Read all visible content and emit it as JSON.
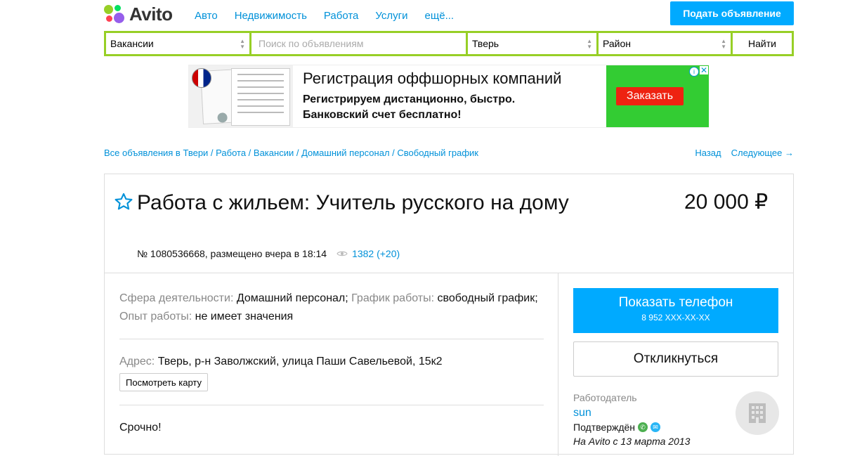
{
  "header": {
    "logo_text": "Avito",
    "nav": [
      "Авто",
      "Недвижимость",
      "Работа",
      "Услуги",
      "ещё..."
    ],
    "post_button": "Подать объявление"
  },
  "search": {
    "category": "Вакансии",
    "query_placeholder": "Поиск по объявлениям",
    "city": "Тверь",
    "district": "Район",
    "submit": "Найти"
  },
  "ad": {
    "title": "Регистрация оффшорных компаний",
    "line1": "Регистрируем дистанционно, быстро.",
    "line2": "Банковский счет бесплатно!",
    "cta": "Заказать"
  },
  "breadcrumbs": [
    "Все объявления в Твери",
    "Работа",
    "Вакансии",
    "Домашний персонал",
    "Свободный график"
  ],
  "pager": {
    "back": "Назад",
    "next": "Следующее →"
  },
  "listing": {
    "title": "Работа с жильем: Учитель русского на дому",
    "price": "20 000 ₽",
    "meta": "№ 1080536668, размещено вчера в 18:14",
    "views": "1382 (+20)",
    "params": {
      "sphere_label": "Сфера деятельности:",
      "sphere_value": "Домашний персонал;",
      "schedule_label": "График работы:",
      "schedule_value": "свободный график;",
      "experience_label": "Опыт работы:",
      "experience_value": "не имеет значения"
    },
    "address_label": "Адрес:",
    "address_value": "Тверь, р-н Заволжский, улица Паши Савельевой, 15к2",
    "map_button": "Посмотреть карту",
    "description": "Срочно!"
  },
  "sidebar": {
    "phone_button": "Показать телефон",
    "phone_masked": "8 952 XXX-XX-XX",
    "reply_button": "Откликнуться",
    "employer_label": "Работодатель",
    "employer_name": "sun",
    "confirmed": "Подтверждён",
    "since": "На Avito с 13 марта 2013"
  },
  "colors": {
    "accent_blue": "#00aaff",
    "search_green": "#97cf26",
    "ad_red": "#ee2211"
  }
}
